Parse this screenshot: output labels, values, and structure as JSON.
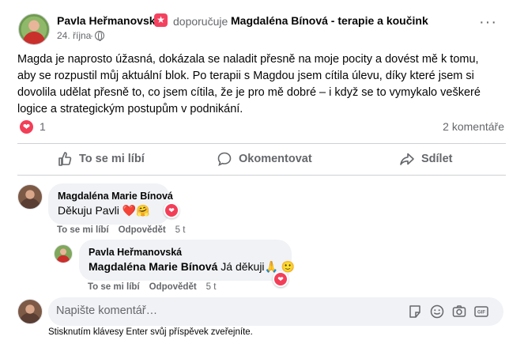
{
  "post": {
    "author": "Pavla Heřmanovská",
    "recommend_verb": "doporučuje",
    "recommended_page": "Magdaléna Bínová - terapie a koučink",
    "date": "24. října",
    "date_separator": "·",
    "body": "Magda je naprosto úžasná, dokázala se naladit přesně na moje pocity a dovést mě k tomu, aby se rozpustil můj aktuální blok. Po terapii s Magdou jsem cítila úlevu, díky které jsem si dovolila udělat přesně to, co jsem cítila, že je pro mě dobré – i když se to vymykalo veškeré logice a strategickým postupům v podnikání.",
    "reaction_count": "1",
    "comment_count": "2 komentáře",
    "colors": {
      "accent": "#1877f2",
      "heart": "#f33e58",
      "recommend_badge": "#f3425f",
      "bubble": "#f0f2f5",
      "muted": "#65676b"
    }
  },
  "actions": {
    "like": "To se mi líbí",
    "comment": "Okomentovat",
    "share": "Sdílet"
  },
  "comments": [
    {
      "author": "Magdaléna Marie Bínová",
      "text": "Děkuju Pavli ❤️🤗",
      "like": "To se mi líbí",
      "reply": "Odpovědět",
      "time": "5 t"
    },
    {
      "author": "Pavla Heřmanovská",
      "mention": "Magdaléna Marie Bínová",
      "text": " Já děkuji🙏 🙂",
      "like": "To se mi líbí",
      "reply": "Odpovědět",
      "time": "5 t"
    }
  ],
  "composer": {
    "placeholder": "Napište komentář…",
    "hint": "Stisknutím klávesy Enter svůj příspěvek zveřejníte."
  },
  "icons": [
    "star-icon",
    "globe-icon",
    "more-icon",
    "heart-icon",
    "like-icon",
    "comment-icon",
    "share-icon",
    "emoji-icon",
    "camera-icon",
    "gif-icon",
    "sticker-icon"
  ]
}
